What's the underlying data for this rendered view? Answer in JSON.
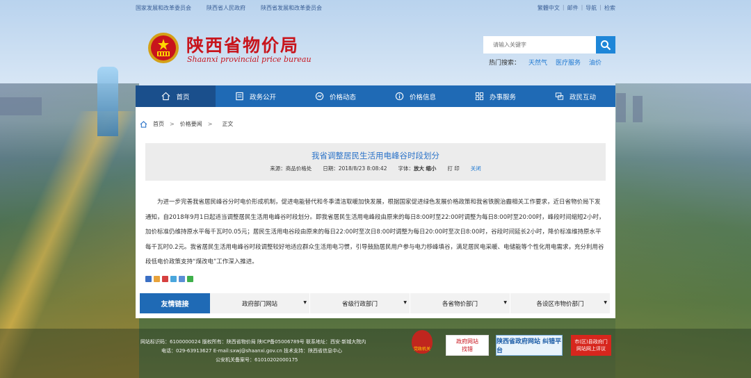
{
  "top_links": {
    "left": [
      "国家发展和改革委员会",
      "陕西省人民政府",
      "陕西省发展和改革委员会"
    ],
    "right": [
      "繁體中文",
      "|",
      "邮件",
      "|",
      "导航",
      "|",
      "检索"
    ]
  },
  "logo": {
    "cn": "陕西省物价局",
    "en": "Shaanxi provincial price bureau"
  },
  "search": {
    "placeholder": "请输入关键字"
  },
  "hot": {
    "label": "热门搜索：",
    "keywords": [
      "天然气",
      "医疗服务",
      "油价"
    ]
  },
  "nav": [
    {
      "label": "首页",
      "icon": "home-icon"
    },
    {
      "label": "政务公开",
      "icon": "document-icon"
    },
    {
      "label": "价格动态",
      "icon": "trend-icon"
    },
    {
      "label": "价格信息",
      "icon": "info-icon"
    },
    {
      "label": "办事服务",
      "icon": "grid-icon"
    },
    {
      "label": "政民互动",
      "icon": "chat-icon"
    }
  ],
  "breadcrumb": {
    "items": [
      "首页",
      "价格要闻",
      "正文"
    ],
    "sep": ">"
  },
  "article": {
    "title": "我省调整居民生活用电峰谷时段划分",
    "source": "来源：商品价格处",
    "date": "日期：2018/8/23 8:08:42",
    "font_label": "字体：",
    "font_big": "放大",
    "font_small": "缩小",
    "print": "打 印",
    "close": "关闭",
    "body": "为进一步完善我省居民峰谷分时电价形成机制，促进电能替代和冬季清洁取暖加快发展，根据国家促进绿色发展价格政策和我省铁腕治霾相关工作要求，近日省物价局下发通知，自2018年9月1日起适当调整居民生活用电峰谷时段划分。即我省居民生活用电峰段由原来的每日8:00时至22:00时调整为每日8:00时至20:00时，峰段时间缩短2小时，加价标准仍维持原水平每千瓦时0.05元；居民生活用电谷段由原来的每日22:00时至次日8:00时调整为每日20:00时至次日8:00时，谷段时间延长2小时，降价标准维持原水平每千瓦时0.2元。我省居民生活用电峰谷时段调整较好地适应群众生活用电习惯，引导鼓励居民用户参与电力移峰填谷，满足居民电采暖、电储能等个性化用电需求，充分利用谷段低电价政策支持“煤改电”工作深入推进。"
  },
  "friend_links": {
    "title": "友情链接",
    "selects": [
      "政府部门网站",
      "省级行政部门",
      "各省物价部门",
      "各设区市物价部门"
    ]
  },
  "footer": {
    "line1": "网站标识码：6100000024 版权所有：陕西省物价局 陕ICP备05006789号 联系地址：西安·新城大院内",
    "line2": "电话：029-63913627 E-mail:sxwj@shaanxi.gov.cn 技术支持：陕西省信息中心",
    "line3": "公安机关备案号：61010202000175",
    "party_badge": "党政机关",
    "find_badge_top": "政府网站",
    "find_badge_bottom": "找错",
    "gov_badge": "陕西省政府网站 纠错平台",
    "county_badge_top": "市(区)县政府门",
    "county_badge_bottom": "网站网上评议"
  },
  "colors": {
    "nav_blue": "#1f6ab5",
    "title_blue": "#2b73c8",
    "logo_red": "#c8141c"
  }
}
